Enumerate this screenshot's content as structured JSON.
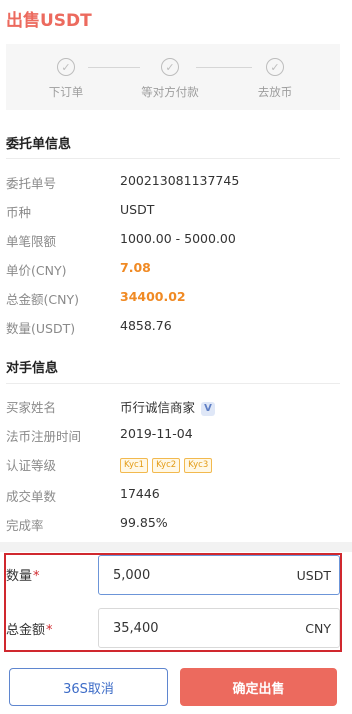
{
  "page": {
    "title": "出售USDT"
  },
  "steps": [
    {
      "label": "下订单",
      "icon": "check-icon"
    },
    {
      "label": "等对方付款",
      "icon": "check-icon"
    },
    {
      "label": "去放币",
      "icon": "check-icon"
    }
  ],
  "order_info": {
    "title": "委托单信息",
    "rows": [
      {
        "key": "委托单号",
        "value": "200213081137745"
      },
      {
        "key": "币种",
        "value": "USDT"
      },
      {
        "key": "单笔限额",
        "value": "1000.00 - 5000.00"
      },
      {
        "key": "单价(CNY)",
        "value": "7.08"
      },
      {
        "key": "总金额(CNY)",
        "value": "34400.02"
      },
      {
        "key": "数量(USDT)",
        "value": "4858.76"
      }
    ]
  },
  "counterparty": {
    "title": "对手信息",
    "buyer_label": "买家姓名",
    "buyer_name": "币行诚信商家",
    "verified_badge": "V",
    "reg_label": "法币注册时间",
    "reg_date": "2019-11-04",
    "cert_label": "认证等级",
    "kyc_badges": [
      "Kyc1",
      "Kyc2",
      "Kyc3"
    ],
    "deals_label": "成交单数",
    "deals": "17446",
    "rate_label": "完成率",
    "rate": "99.85%"
  },
  "form": {
    "quantity_label": "数量",
    "quantity_value": "5,000",
    "quantity_unit": "USDT",
    "total_label": "总金额",
    "total_value": "35,400",
    "total_unit": "CNY",
    "required_mark": "*"
  },
  "buttons": {
    "cancel": "36S取消",
    "confirm": "确定出售"
  },
  "colors": {
    "accent": "#ec6a5e",
    "price": "#f08a24",
    "frame": "#d0282e",
    "link": "#3d6cc7"
  }
}
